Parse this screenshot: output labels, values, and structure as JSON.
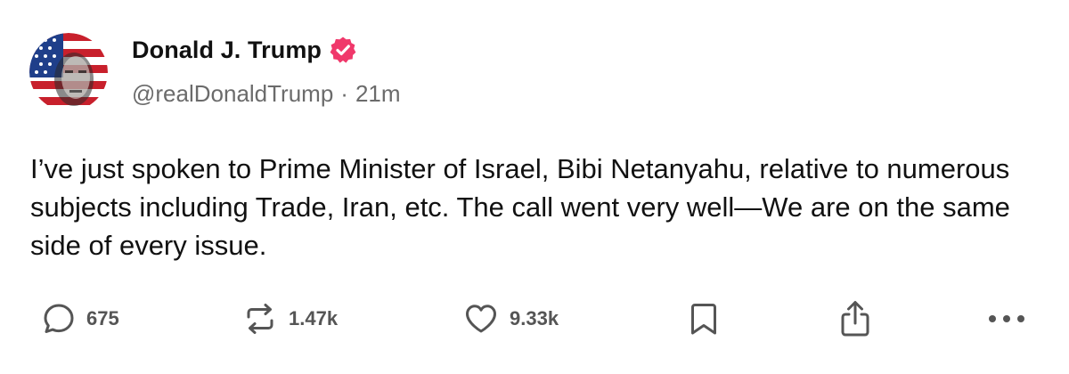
{
  "post": {
    "author": {
      "display_name": "Donald J. Trump",
      "handle": "@realDonaldTrump",
      "verified": true,
      "verified_color": "#f0386b"
    },
    "timestamp": "21m",
    "separator": "·",
    "text": "I’ve just spoken to Prime Minister of Israel, Bibi Netanyahu, relative to numerous subjects including Trade, Iran, etc. The call went very well—We are on the same side of every issue."
  },
  "actions": {
    "reply": {
      "icon": "reply-icon",
      "count": "675"
    },
    "repost": {
      "icon": "repost-icon",
      "count": "1.47k"
    },
    "like": {
      "icon": "heart-icon",
      "count": "9.33k"
    },
    "bookmark": {
      "icon": "bookmark-icon"
    },
    "share": {
      "icon": "share-icon"
    },
    "more": {
      "icon": "more-icon"
    }
  },
  "colors": {
    "text": "#111111",
    "secondary_text": "#6b6b6b",
    "icon": "#555555",
    "accent": "#f0386b"
  }
}
